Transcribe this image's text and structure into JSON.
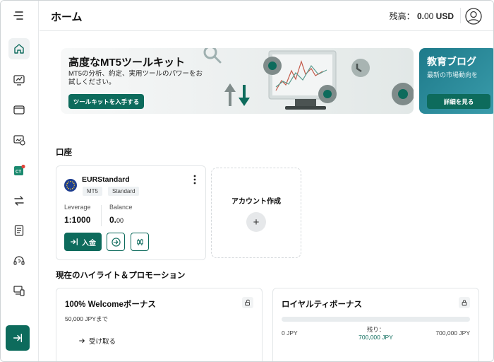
{
  "header": {
    "title": "ホーム",
    "balance_label": "残高：",
    "balance_amount": "0.",
    "balance_cents": "00",
    "balance_currency": "USD"
  },
  "sidebar": {
    "items": [
      "home-icon",
      "chart-icon",
      "wallet-icon",
      "analytics-icon",
      "copy-trading-icon",
      "transfer-icon",
      "document-icon",
      "support-icon",
      "devices-icon"
    ],
    "collapse_icon": "collapse-icon"
  },
  "banner": {
    "title": "高度なMT5ツールキット",
    "text": "MT5の分析、約定、実用ツールのパワーをお試しください。",
    "button": "ツールキットを入手する"
  },
  "banner2": {
    "title": "教育ブログ",
    "text": "最新の市場動向を",
    "button": "詳細を見る"
  },
  "accounts": {
    "section_title": "口座",
    "card": {
      "name": "EURStandard",
      "tags": [
        "MT5",
        "Standard"
      ],
      "leverage_label": "Leverage",
      "leverage_value": "1:1000",
      "balance_label": "Balance",
      "balance_value": "0.",
      "balance_cents": "00",
      "deposit_button": "入金"
    },
    "create": {
      "label": "アカウント作成",
      "plus": "+"
    }
  },
  "promotions": {
    "section_title": "現在のハイライト＆プロモーション",
    "welcome": {
      "title": "100% Welcomeボーナス",
      "subtitle": "50,000 JPYまで",
      "claim": "受け取る"
    },
    "loyalty": {
      "title": "ロイヤルティボーナス",
      "min": "0 JPY",
      "remaining_label": "残り：",
      "remaining_value": "700,000 JPY",
      "max": "700,000 JPY",
      "progress_percent": 0
    }
  },
  "colors": {
    "brand": "#0d6b5c",
    "tag_bg": "#eef1f3"
  }
}
